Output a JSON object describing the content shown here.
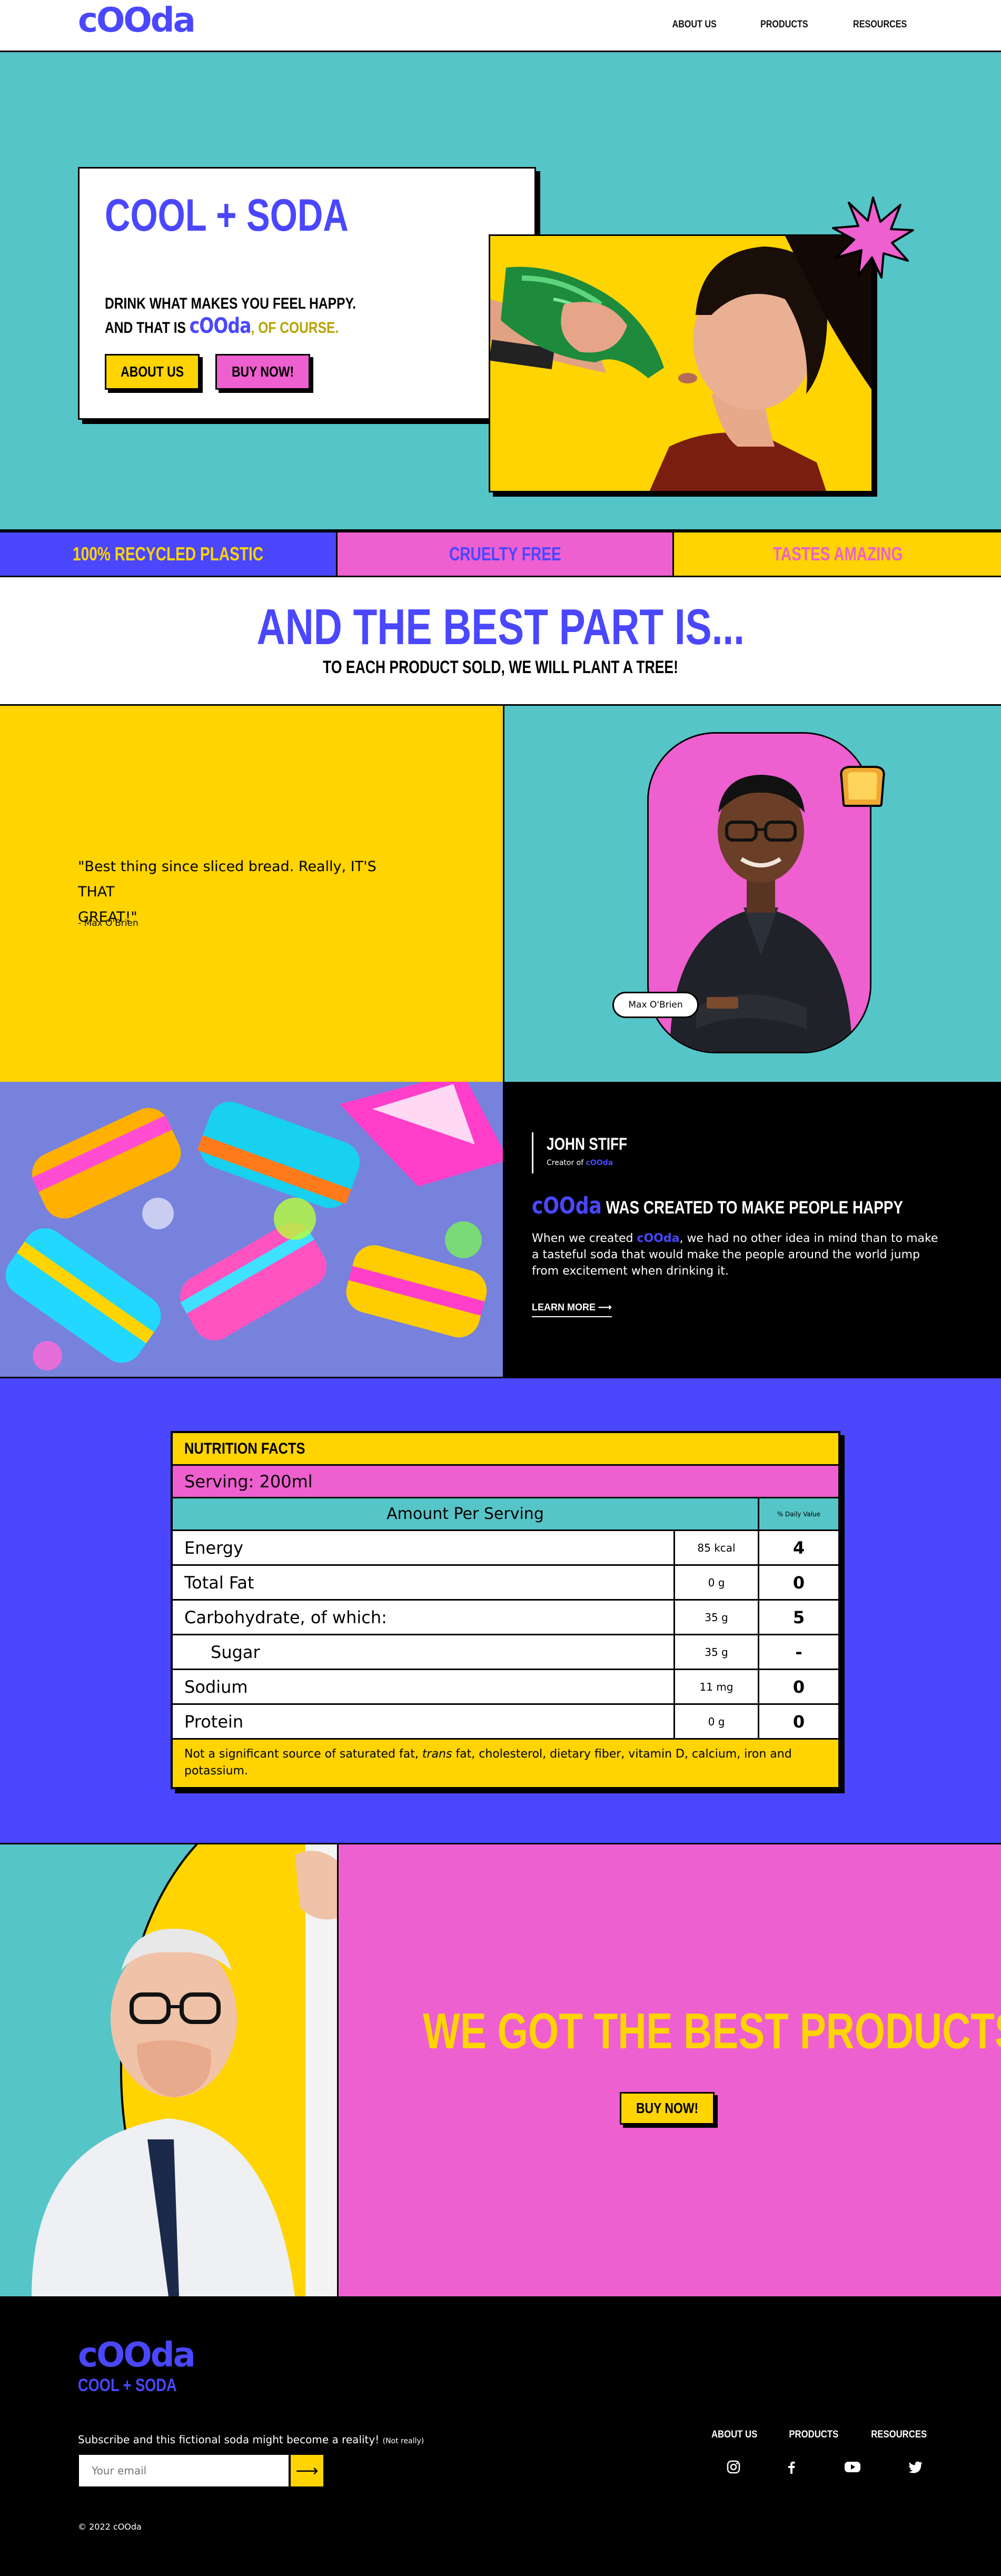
{
  "nav": {
    "logo": "cOOda",
    "links": [
      "ABOUT US",
      "PRODUCTS",
      "RESOURCES"
    ]
  },
  "hero": {
    "title": "COOL + SODA",
    "line1": "DRINK WHAT MAKES YOU FEEL HAPPY.",
    "line2_prefix": "AND THAT IS ",
    "line2_brand": "cOOda",
    "line2_suffix": ", OF COURSE.",
    "btn_about": "ABOUT US",
    "btn_buy": "BUY NOW!"
  },
  "strips": [
    "100% RECYCLED PLASTIC",
    "CRUELTY FREE",
    "TASTES AMAZING"
  ],
  "best": {
    "title": "AND THE BEST PART IS...",
    "subtitle": "TO EACH PRODUCT SOLD, WE WILL PLANT A TREE!"
  },
  "testimonial": {
    "quote_line1": "\"Best thing since sliced bread. Really, IT'S THAT",
    "quote_line2": "GREAT!\"",
    "author": "- Max O'Brien",
    "name_pill": "Max O'Brien"
  },
  "story": {
    "name": "JOHN STIFF",
    "role_prefix": "Creator of ",
    "role_brand": "cOOda",
    "headline_brand": "cOOda",
    "headline_rest": " WAS CREATED TO MAKE PEOPLE HAPPY",
    "body_prefix": "When we created ",
    "body_brand": "cOOda",
    "body_rest": ", we had no other idea in mind than to make a tasteful soda that would make the people around the world jump from excitement when drinking it.",
    "learn_more": "LEARN MORE ⟶"
  },
  "nutrition": {
    "title": "NUTRITION FACTS",
    "serving": "Serving: 200ml",
    "amount_header": "Amount Per Serving",
    "dv_header": "% Daily Value",
    "rows": [
      {
        "name": "Energy",
        "amount": "85 kcal",
        "dv": "4"
      },
      {
        "name": "Total Fat",
        "amount": "0 g",
        "dv": "0"
      },
      {
        "name": "Carbohydrate, of which:",
        "amount": "35 g",
        "dv": "5"
      },
      {
        "name": "Sugar",
        "amount": "35 g",
        "dv": "-"
      },
      {
        "name": "Sodium",
        "amount": "11 mg",
        "dv": "0"
      },
      {
        "name": "Protein",
        "amount": "0 g",
        "dv": "0"
      }
    ],
    "footnote_prefix": "Not a significant source of saturated fat, ",
    "footnote_italic": "trans",
    "footnote_rest": " fat, cholesterol, dietary fiber, vitamin D, calcium, iron and potassium."
  },
  "products": {
    "title": "WE GOT THE BEST PRODUCTS",
    "button": "BUY NOW!"
  },
  "footer": {
    "logo": "cOOda",
    "tagline": "COOL + SODA",
    "subscribe": "Subscribe and this fictional soda might become a reality! ",
    "subscribe_small": "(Not really)",
    "email_placeholder": "Your email",
    "go": "⟶",
    "links": [
      "ABOUT US",
      "PRODUCTS",
      "RESOURCES"
    ],
    "social": [
      "instagram-icon",
      "facebook-icon",
      "youtube-icon",
      "twitter-icon"
    ],
    "copyright": "© 2022 cOOda"
  },
  "colors": {
    "brand_blue": "#4a47ff",
    "yellow": "#ffd400",
    "pink": "#ee5fcf",
    "teal": "#56c5c8"
  }
}
